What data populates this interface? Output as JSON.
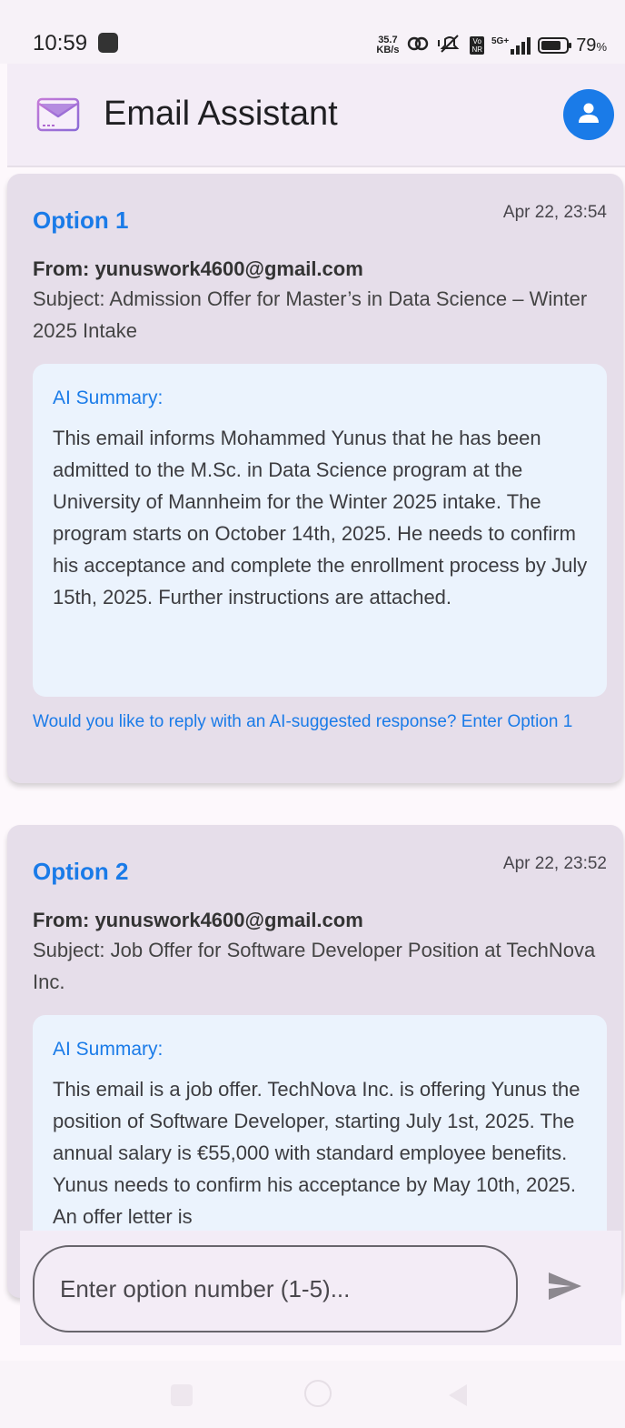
{
  "status_bar": {
    "time": "10:59",
    "net_speed_value": "35.7",
    "net_speed_unit": "KB/s",
    "network_type": "5G+",
    "volte_label_top": "Vo",
    "volte_label_bottom": "NR",
    "battery_level_percent": 79,
    "battery_text": "79",
    "battery_unit": "%"
  },
  "app_bar": {
    "title": "Email Assistant",
    "logo_icon": "mail-envelope-icon",
    "profile_icon": "person-icon"
  },
  "emails": [
    {
      "option": "Option 1",
      "date": "Apr 22, 23:54",
      "from": "From: yunuswork4600@gmail.com",
      "subject": "Subject: Admission Offer for Master’s in Data Science – Winter 2025 Intake",
      "summary_title": "AI Summary:",
      "summary": "This email informs Mohammed Yunus that he has been admitted to the M.Sc. in Data Science program at the University of Mannheim for the Winter 2025 intake. The program starts on October 14th, 2025. He needs to confirm his acceptance and complete the enrollment process by July 15th, 2025. Further instructions are attached.",
      "reply_prompt": "Would you like to reply with an AI-suggested response? Enter Option 1"
    },
    {
      "option": "Option 2",
      "date": "Apr 22, 23:52",
      "from": "From: yunuswork4600@gmail.com",
      "subject": "Subject: Job Offer for Software Developer Position at TechNova Inc.",
      "summary_title": "AI Summary:",
      "summary": "This email is a job offer. TechNova Inc. is offering Yunus the position of Software Developer, starting July 1st, 2025. The annual salary is €55,000 with standard employee benefits. Yunus needs to confirm his acceptance by May 10th, 2025. An offer letter is"
    }
  ],
  "input": {
    "value": "",
    "placeholder": "Enter option number (1-5)..."
  },
  "colors": {
    "accent": "#1a7be8",
    "card_background": "#e6deea",
    "summary_background": "#ebf3fd",
    "app_bar_background": "#f3ecf6"
  }
}
